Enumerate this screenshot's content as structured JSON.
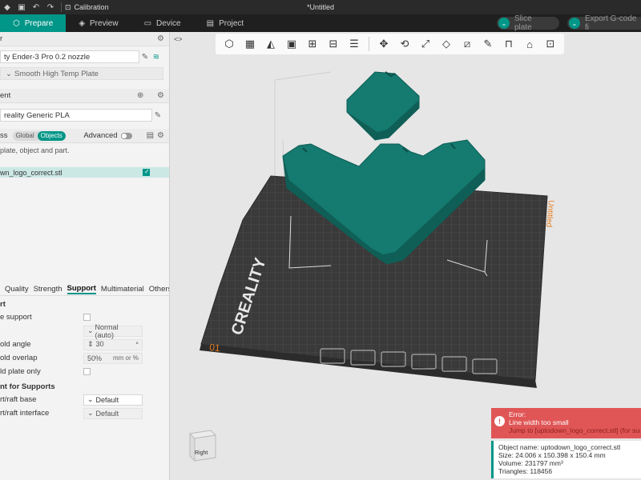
{
  "titlebar": {
    "calibration_label": "Calibration",
    "document_title": "*Untitled"
  },
  "tabs": [
    {
      "label": "Prepare",
      "icon": "cube-icon"
    },
    {
      "label": "Preview",
      "icon": "layers-icon"
    },
    {
      "label": "Device",
      "icon": "device-icon"
    },
    {
      "label": "Project",
      "icon": "project-icon"
    }
  ],
  "actions": {
    "slice_label": "Slice plate",
    "export_label": "Export G-code fi"
  },
  "printer": {
    "head": "r",
    "name": "ty Ender-3 Pro 0.2 nozzle",
    "plate": "Smooth High Temp Plate"
  },
  "filament": {
    "head": "ent",
    "name": "reality Generic PLA"
  },
  "process": {
    "head": "ss",
    "scope_global": "Global",
    "scope_objects": "Objects",
    "advanced_label": "Advanced",
    "hint": "plate, object and part."
  },
  "objects": [
    {
      "name": "wn_logo_correct.stl",
      "checked": true
    }
  ],
  "prop_tabs": [
    "Quality",
    "Strength",
    "Support",
    "Multimaterial",
    "Others"
  ],
  "prop_tabs_active": "Support",
  "support": {
    "group1": "rt",
    "enable_label": "e support",
    "type_value": "Normal (auto)",
    "threshold_angle_label": "old angle",
    "threshold_angle_value": "30",
    "threshold_angle_unit": "°",
    "threshold_overlap_label": "old overlap",
    "threshold_overlap_value": "50%",
    "threshold_overlap_unit": "mm or %",
    "build_plate_only_label": "ld plate only",
    "group2": "nt for Supports",
    "raft_base_label": "rt/raft base",
    "raft_base_value": "Default",
    "raft_interface_label": "rt/raft interface",
    "raft_interface_value": "Default"
  },
  "plate": {
    "brand": "CREALITY",
    "plate_number": "01",
    "plate_name": "Untitled"
  },
  "error": {
    "title": "Error:",
    "message": "Line width too small",
    "link": "Jump to [uptodown_logo_correct.stl] (for surface)"
  },
  "info": {
    "name": "Object name: uptodown_logo_correct.stl",
    "size": "Size: 24.006 x 150.398 x 150.4 mm",
    "volume": "Volume: 231797 mm³",
    "triangles": "Triangles: 118456"
  },
  "viewcube_label": "Right",
  "colors": {
    "accent": "#009688",
    "model": "#157a70",
    "error": "#e05656",
    "bed": "#3c3c3c"
  }
}
